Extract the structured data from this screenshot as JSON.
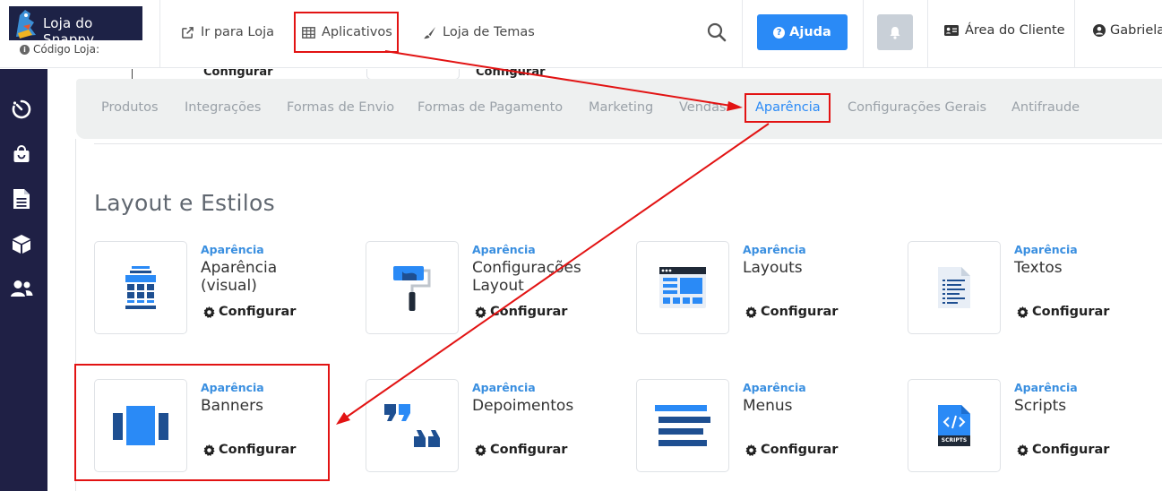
{
  "header": {
    "logo_text": "Loja do Snappy",
    "store_code_label": "Código Loja:",
    "nav": [
      {
        "label": "Ir para Loja",
        "icon": "external-link-icon"
      },
      {
        "label": "Aplicativos",
        "icon": "grid-table-icon"
      },
      {
        "label": "Loja de Temas",
        "icon": "paint-brush-icon"
      }
    ],
    "help_label": "Ajuda",
    "client_area_label": "Área do Cliente",
    "user_label": "Gabriela"
  },
  "sidebar": {
    "items": [
      {
        "icon": "stopwatch-icon"
      },
      {
        "icon": "shopping-bag-icon"
      },
      {
        "icon": "document-icon"
      },
      {
        "icon": "box-icon"
      },
      {
        "icon": "users-icon"
      }
    ]
  },
  "background_cards": {
    "config_label": "Configurar"
  },
  "tabs": [
    {
      "label": "Produtos"
    },
    {
      "label": "Integrações"
    },
    {
      "label": "Formas de Envio"
    },
    {
      "label": "Formas de Pagamento"
    },
    {
      "label": "Marketing"
    },
    {
      "label": "Vendas"
    },
    {
      "label": "Aparência",
      "active": true
    },
    {
      "label": "Configurações Gerais"
    },
    {
      "label": "Antifraude"
    }
  ],
  "section": {
    "title": "Layout e Estilos"
  },
  "cards": [
    {
      "category": "Aparência",
      "name_line1": "Aparência",
      "name_line2": "(visual)",
      "config": "Configurar",
      "icon": "visual-editor-icon"
    },
    {
      "category": "Aparência",
      "name_line1": "Configurações",
      "name_line2": "Layout",
      "config": "Configurar",
      "icon": "paint-roller-icon"
    },
    {
      "category": "Aparência",
      "name_line1": "Layouts",
      "name_line2": "",
      "config": "Configurar",
      "icon": "layout-window-icon"
    },
    {
      "category": "Aparência",
      "name_line1": "Textos",
      "name_line2": "",
      "config": "Configurar",
      "icon": "text-document-icon"
    },
    {
      "category": "Aparência",
      "name_line1": "Banners",
      "name_line2": "",
      "config": "Configurar",
      "icon": "banner-slider-icon"
    },
    {
      "category": "Aparência",
      "name_line1": "Depoimentos",
      "name_line2": "",
      "config": "Configurar",
      "icon": "quote-marks-icon"
    },
    {
      "category": "Aparência",
      "name_line1": "Menus",
      "name_line2": "",
      "config": "Configurar",
      "icon": "menu-lines-icon"
    },
    {
      "category": "Aparência",
      "name_line1": "Scripts",
      "name_line2": "",
      "config": "Configurar",
      "icon": "scripts-file-icon",
      "badge": "SCRIPTS"
    }
  ],
  "colors": {
    "accent": "#2a8af6",
    "sidebar_bg": "#1f2045",
    "annotation_red": "#e21313",
    "icon_blue": "#2a8af6",
    "icon_dark_blue": "#1e4f91"
  }
}
